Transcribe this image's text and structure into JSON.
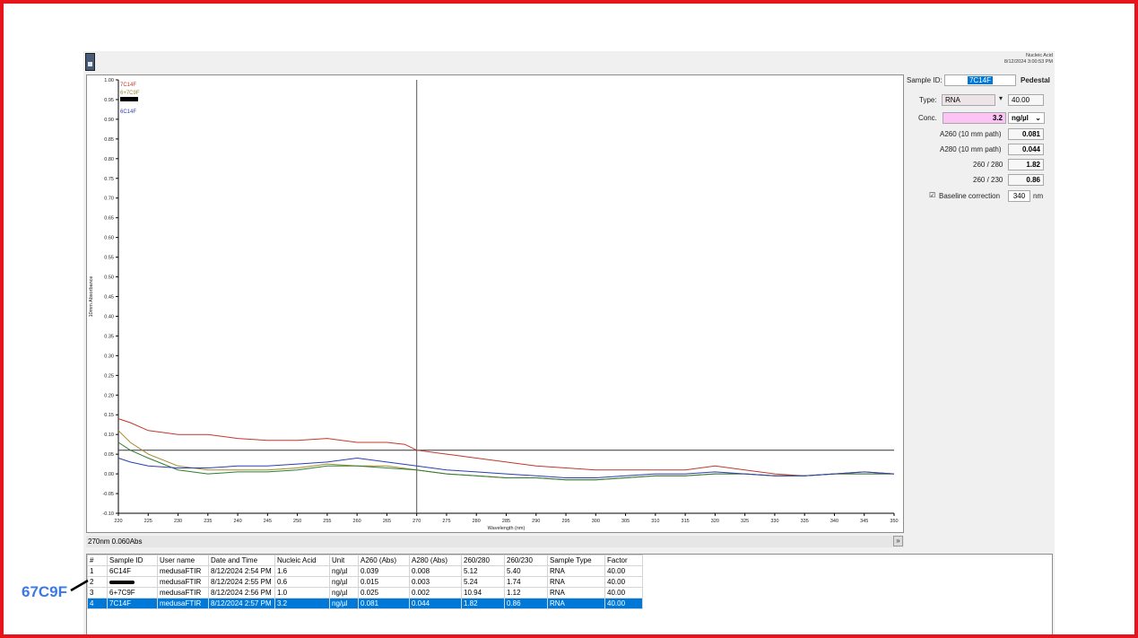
{
  "header": {
    "line1": "Nucleic Acid",
    "line2": "8/12/2024 3:00:53 PM"
  },
  "chart_data": {
    "type": "line",
    "title": "",
    "xlabel": "Wavelength (nm)",
    "ylabel": "10mm Absorbance",
    "xlim": [
      220,
      350
    ],
    "ylim": [
      -0.1,
      1.0
    ],
    "xticks": [
      220,
      225,
      230,
      235,
      240,
      245,
      250,
      255,
      260,
      265,
      270,
      275,
      280,
      285,
      290,
      295,
      300,
      305,
      310,
      315,
      320,
      325,
      330,
      335,
      340,
      345,
      350
    ],
    "yticks": [
      -0.1,
      -0.05,
      0.0,
      0.05,
      0.1,
      0.15,
      0.2,
      0.25,
      0.3,
      0.35,
      0.4,
      0.45,
      0.5,
      0.55,
      0.6,
      0.65,
      0.7,
      0.75,
      0.8,
      0.85,
      0.9,
      0.95,
      1.0
    ],
    "cursor": {
      "x": 270,
      "y": 0.06
    },
    "legend_position": "top-left",
    "series": [
      {
        "name": "7C14F",
        "color": "#c0392b",
        "x": [
          220,
          222,
          225,
          230,
          235,
          240,
          245,
          250,
          255,
          260,
          265,
          268,
          270,
          275,
          280,
          285,
          290,
          295,
          300,
          305,
          310,
          315,
          320,
          325,
          330,
          335,
          340,
          345,
          350
        ],
        "y": [
          0.14,
          0.13,
          0.11,
          0.1,
          0.1,
          0.09,
          0.085,
          0.085,
          0.09,
          0.08,
          0.08,
          0.075,
          0.06,
          0.05,
          0.04,
          0.03,
          0.02,
          0.015,
          0.01,
          0.01,
          0.01,
          0.01,
          0.02,
          0.01,
          0.0,
          -0.005,
          0.0,
          0.005,
          0.0
        ]
      },
      {
        "name": "6+7C9F",
        "color": "#a08a2c",
        "x": [
          220,
          222,
          225,
          230,
          235,
          240,
          245,
          250,
          255,
          260,
          265,
          270,
          275,
          280,
          285,
          290,
          295,
          300,
          305,
          310,
          315,
          320,
          325,
          330,
          335,
          340,
          345,
          350
        ],
        "y": [
          0.11,
          0.08,
          0.05,
          0.02,
          0.01,
          0.01,
          0.01,
          0.015,
          0.025,
          0.02,
          0.02,
          0.01,
          0.0,
          -0.005,
          -0.01,
          -0.01,
          -0.015,
          -0.015,
          -0.01,
          -0.005,
          -0.005,
          0.0,
          0.0,
          -0.005,
          -0.005,
          0.0,
          0.0,
          0.0
        ]
      },
      {
        "name": "",
        "color": "#2e7d32",
        "x": [
          220,
          222,
          225,
          230,
          235,
          240,
          245,
          250,
          255,
          260,
          265,
          270,
          275,
          280,
          285,
          290,
          295,
          300,
          305,
          310,
          315,
          320,
          325,
          330,
          335,
          340,
          345,
          350
        ],
        "y": [
          0.08,
          0.06,
          0.04,
          0.01,
          0.0,
          0.005,
          0.005,
          0.01,
          0.02,
          0.02,
          0.015,
          0.01,
          0.0,
          -0.005,
          -0.01,
          -0.01,
          -0.015,
          -0.015,
          -0.01,
          -0.005,
          -0.005,
          0.0,
          0.0,
          -0.005,
          -0.005,
          0.0,
          0.0,
          0.0
        ]
      },
      {
        "name": "6C14F",
        "color": "#2c3fb0",
        "x": [
          220,
          222,
          225,
          230,
          235,
          240,
          245,
          250,
          255,
          260,
          265,
          270,
          275,
          280,
          285,
          290,
          295,
          300,
          305,
          310,
          315,
          320,
          325,
          330,
          335,
          340,
          345,
          350
        ],
        "y": [
          0.04,
          0.03,
          0.02,
          0.015,
          0.015,
          0.02,
          0.02,
          0.025,
          0.03,
          0.04,
          0.03,
          0.02,
          0.01,
          0.005,
          0.0,
          -0.005,
          -0.01,
          -0.01,
          -0.005,
          0.0,
          0.0,
          0.005,
          0.0,
          -0.005,
          -0.005,
          0.0,
          0.005,
          0.0
        ]
      }
    ]
  },
  "status": {
    "readout": "270nm 0.060Abs"
  },
  "side": {
    "sample_id_label": "Sample ID:",
    "sample_id": "7C14F",
    "mode": "Pedestal",
    "type_label": "Type:",
    "type_value": "RNA",
    "type_factor": "40.00",
    "conc_label": "Conc.",
    "conc_value": "3.2",
    "conc_unit": "ng/µl",
    "a260_label": "A260 (10 mm path)",
    "a260_value": "0.081",
    "a280_label": "A280 (10 mm path)",
    "a280_value": "0.044",
    "r260_280_label": "260 / 280",
    "r260_280_value": "1.82",
    "r260_230_label": "260 / 230",
    "r260_230_value": "0.86",
    "baseline_label": "Baseline correction",
    "baseline_value": "340",
    "baseline_unit": "nm"
  },
  "table": {
    "headers": [
      "#",
      "Sample ID",
      "User name",
      "Date and Time",
      "Nucleic Acid",
      "Unit",
      "A260 (Abs)",
      "A280 (Abs)",
      "260/280",
      "260/230",
      "Sample Type",
      "Factor"
    ],
    "rows": [
      [
        "1",
        "6C14F",
        "medusaFTIR",
        "8/12/2024 2:54 PM",
        "1.6",
        "ng/µl",
        "0.039",
        "0.008",
        "5.12",
        "5.40",
        "RNA",
        "40.00"
      ],
      [
        "2",
        "",
        "medusaFTIR",
        "8/12/2024 2:55 PM",
        "0.6",
        "ng/µl",
        "0.015",
        "0.003",
        "5.24",
        "1.74",
        "RNA",
        "40.00"
      ],
      [
        "3",
        "6+7C9F",
        "medusaFTIR",
        "8/12/2024 2:56 PM",
        "1.0",
        "ng/µl",
        "0.025",
        "0.002",
        "10.94",
        "1.12",
        "RNA",
        "40.00"
      ],
      [
        "4",
        "7C14F",
        "medusaFTIR",
        "8/12/2024 2:57 PM",
        "3.2",
        "ng/µl",
        "0.081",
        "0.044",
        "1.82",
        "0.86",
        "RNA",
        "40.00"
      ]
    ],
    "selected_row": 3
  },
  "annotation": {
    "text": "67C9F",
    "color": "#3c78e2"
  }
}
